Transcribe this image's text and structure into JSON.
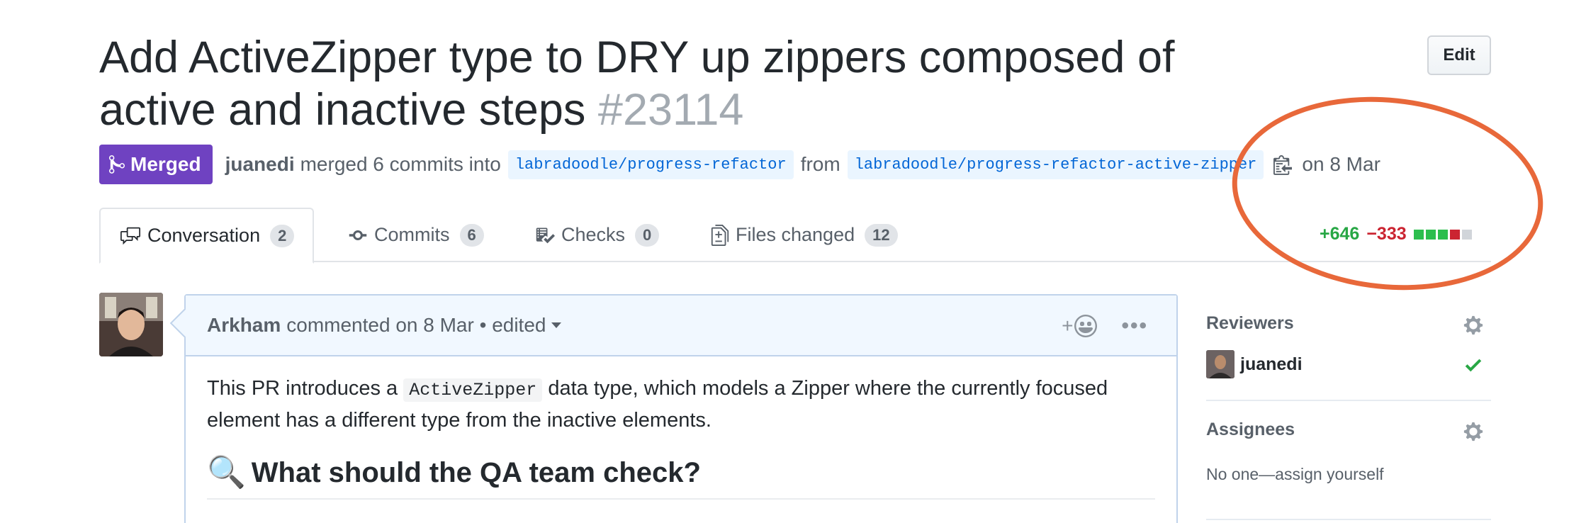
{
  "pr": {
    "title": "Add ActiveZipper type to DRY up zippers composed of active and inactive steps",
    "number": "#23114",
    "edit_label": "Edit",
    "state_label": "Merged",
    "author": "juanedi",
    "merge_text": "merged 6 commits into",
    "base_branch": "labradoodle/progress-refactor",
    "from_text": "from",
    "head_branch": "labradoodle/progress-refactor-active-zipper",
    "date_text": "on 8 Mar"
  },
  "tabs": [
    {
      "label": "Conversation",
      "count": "2",
      "icon": "comment-discussion-icon"
    },
    {
      "label": "Commits",
      "count": "6",
      "icon": "git-commit-icon"
    },
    {
      "label": "Checks",
      "count": "0",
      "icon": "checklist-icon"
    },
    {
      "label": "Files changed",
      "count": "12",
      "icon": "diff-icon"
    }
  ],
  "diffstat": {
    "additions": "+646",
    "deletions": "−333",
    "blocks": [
      "#2cbe4e",
      "#2cbe4e",
      "#2cbe4e",
      "#cb2431",
      "#d1d5da"
    ]
  },
  "comment": {
    "author": "Arkham",
    "action": "commented on 8 Mar • edited",
    "body_pre": "This PR introduces a ",
    "body_code": "ActiveZipper",
    "body_post": " data type, which models a Zipper where the currently focused element has a different type from the inactive elements.",
    "heading_emoji": "🔍",
    "heading": "What should the QA team check?",
    "reaction_plus": "+",
    "more_label": "•••"
  },
  "sidebar": {
    "reviewers_title": "Reviewers",
    "reviewer_name": "juanedi",
    "assignees_title": "Assignees",
    "assignees_empty": "No one—assign yourself"
  },
  "colors": {
    "merged": "#6f42c1",
    "link": "#0366d6",
    "added": "#28a745",
    "deleted": "#cb2431",
    "annotation": "#e8683a"
  }
}
